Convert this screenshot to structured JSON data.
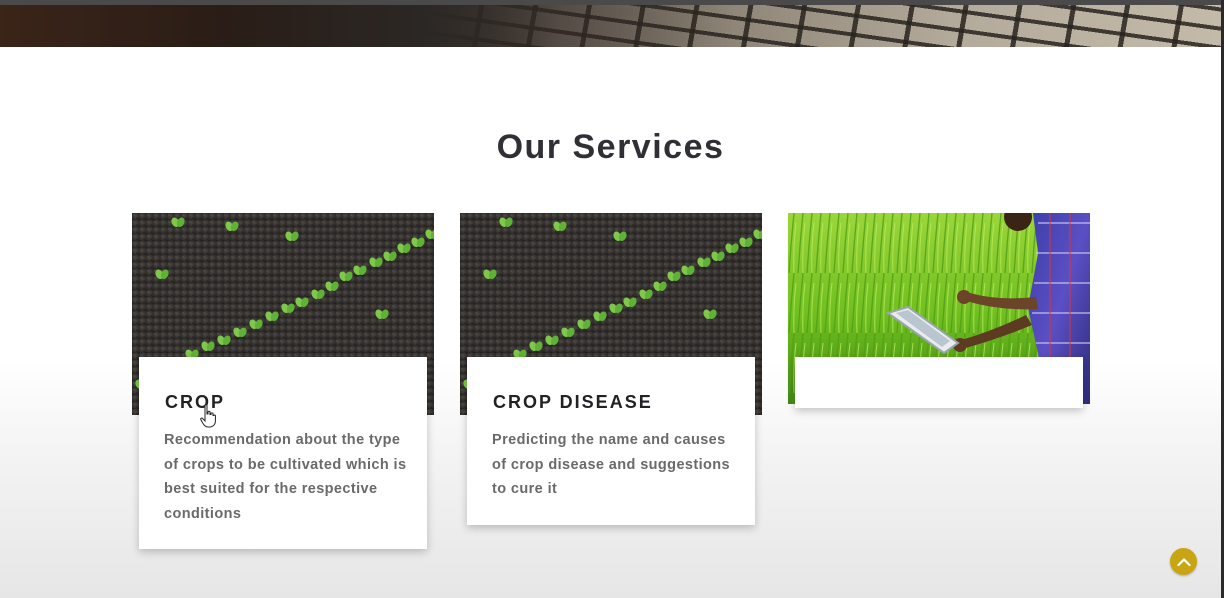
{
  "services": {
    "heading": "Our Services",
    "cards": [
      {
        "title": "CROP",
        "description": "Recommendation about the type of crops to be cultivated which is best suited for the respective conditions",
        "image": "seedling-rows-image"
      },
      {
        "title": "CROP DISEASE",
        "description": "Predicting the name and causes of crop disease and suggestions to cure it",
        "image": "seedling-rows-image"
      },
      {
        "title": "",
        "description": "",
        "image": "farmer-with-tablet-in-rice-field-image"
      }
    ]
  },
  "icons": {
    "cursor": "hand-pointer-icon",
    "scroll_top": "chevron-up-icon"
  },
  "colors": {
    "heading": "#2f2f35",
    "card_title": "#222226",
    "card_text": "#6a6a6a",
    "accent": "#c9a514"
  }
}
